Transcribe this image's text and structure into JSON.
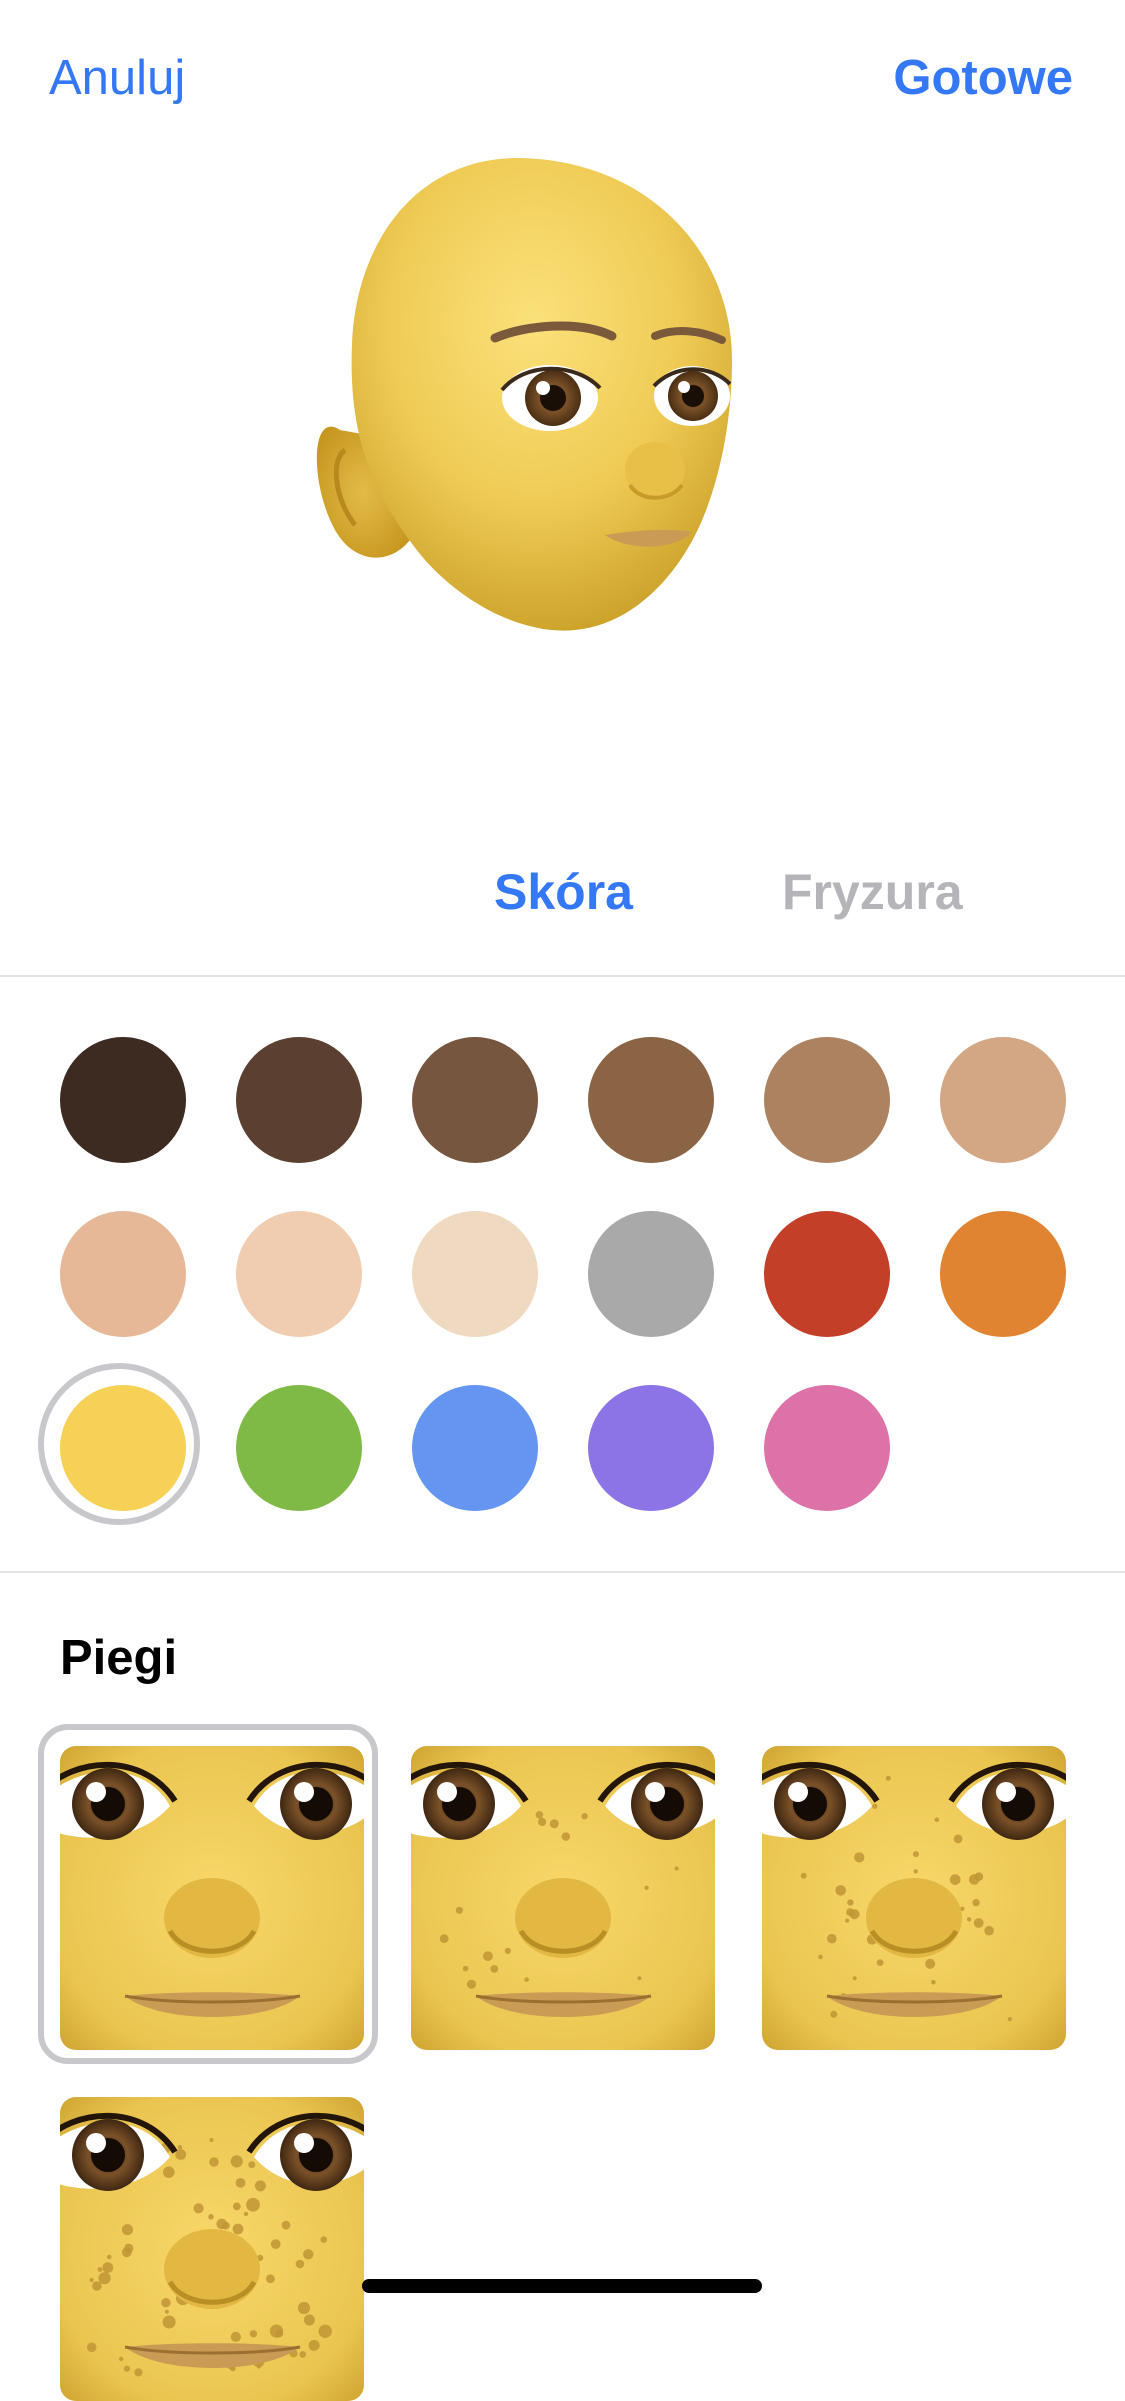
{
  "nav": {
    "cancel_label": "Anuluj",
    "done_label": "Gotowe"
  },
  "tabs": [
    {
      "label": "Skóra",
      "active": true
    },
    {
      "label": "Fryzura",
      "active": false
    }
  ],
  "skin_colors": [
    "#3d2b22",
    "#5b4031",
    "#76563f",
    "#8b6446",
    "#ad8261",
    "#d3a684",
    "#e6b897",
    "#f0cdb0",
    "#efd9c0",
    "#a9a9a9",
    "#c43f28",
    "#e18431",
    "#f6d155",
    "#7fba46",
    "#6395f1",
    "#8c73e6",
    "#dc72a8"
  ],
  "selected_skin_index": 12,
  "freckles": {
    "title": "Piegi",
    "options": [
      {
        "name": "none",
        "density": 0
      },
      {
        "name": "light",
        "density": 1
      },
      {
        "name": "medium",
        "density": 2
      },
      {
        "name": "heavy",
        "density": 3
      }
    ],
    "selected_index": 0
  },
  "colors": {
    "accent": "#3478f6",
    "inactive_tab": "#b4b4b9",
    "divider": "#e2e2e6"
  }
}
